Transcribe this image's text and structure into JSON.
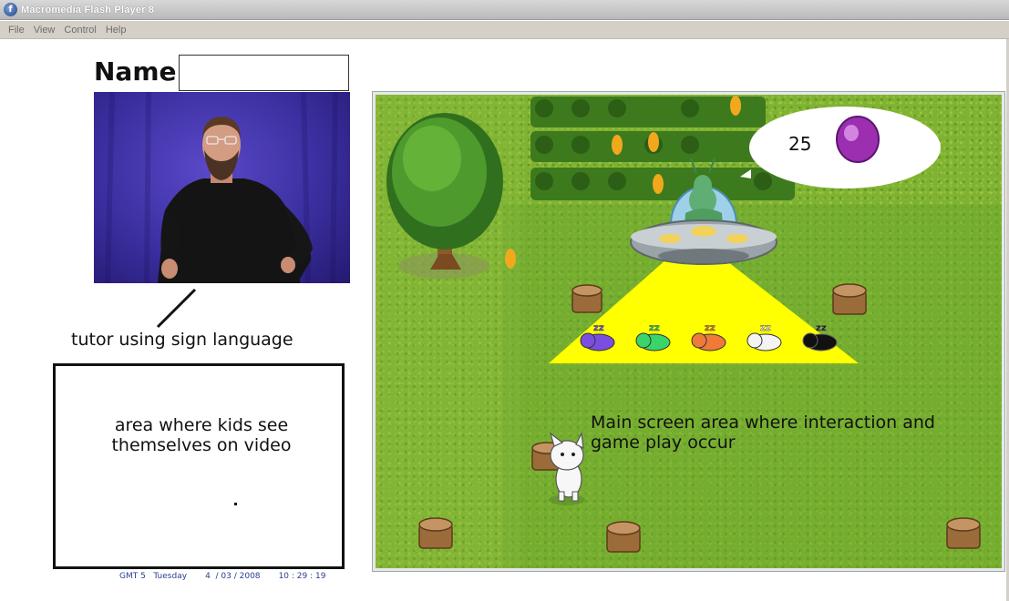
{
  "window": {
    "title": "Macromedia Flash Player 8",
    "menu": [
      "File",
      "View",
      "Control",
      "Help"
    ]
  },
  "name_field": {
    "label": "Name:",
    "value": ""
  },
  "tutor": {
    "caption": "tutor using sign language"
  },
  "self_video": {
    "caption_line1": "area where kids see",
    "caption_line2": "themselves on video"
  },
  "status": {
    "timezone": "GMT 5",
    "day": "Tuesday",
    "date": "4  / 03 / 2008",
    "time": "10 : 29 : 19"
  },
  "game": {
    "score": "25",
    "gem_color": "#9b2fb0",
    "beam_color": "#ffff00",
    "caption_line1": "Main screen area where interaction and",
    "caption_line2": "game play occur",
    "cat_colors": [
      "#7a4fe0",
      "#39d46a",
      "#f07a3a",
      "#f4f4f4",
      "#111111"
    ]
  }
}
